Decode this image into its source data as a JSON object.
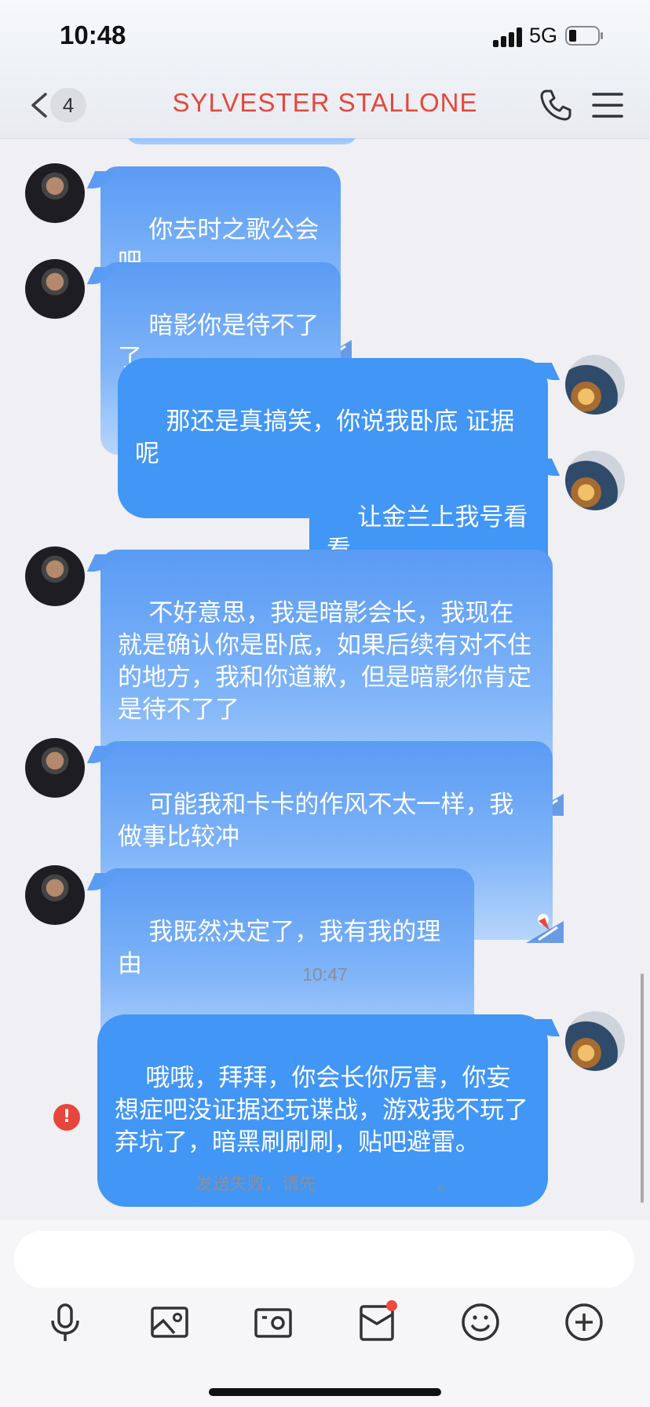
{
  "status_bar": {
    "time": "10:48",
    "network": "5G"
  },
  "header": {
    "back_badge": "4",
    "title": "SYLVESTER STALLONE"
  },
  "messages": [
    {
      "text": "你去时之歌公会吧"
    },
    {
      "text": "暗影你是待不了了"
    },
    {
      "text": "那还是真搞笑，你说我卧底 证据呢"
    },
    {
      "text": "让金兰上我号看看"
    },
    {
      "text": "不好意思，我是暗影会长，我现在就是确认你是卧底，如果后续有对不住的地方，我和你道歉，但是暗影你肯定是待不了了"
    },
    {
      "text": "可能我和卡卡的作风不太一样，我做事比较冲"
    },
    {
      "text": "我既然决定了，我有我的理由"
    },
    {
      "text": "哦哦，拜拜，你会长你厉害，你妄想症吧没证据还玩谍战，游戏我不玩了弃坑了，暗黑刷刷刷，贴吧避雷。"
    }
  ],
  "timestamp": "10:47",
  "failed_indicator": "!",
  "fail_notice": {
    "prefix": "发送失败，请先",
    "link": "添加对方为好友",
    "suffix": "。"
  },
  "toolbar": {
    "icons": [
      "microphone-icon",
      "image-icon",
      "camera-icon",
      "red-packet-icon",
      "emoji-icon",
      "plus-icon"
    ],
    "notification_color": "#ee4a3e"
  },
  "colors": {
    "title": "#e5473d",
    "outgoing_bubble": "#4196f6",
    "incoming_bubble": "#5a9bf4",
    "link": "#4196f6"
  }
}
